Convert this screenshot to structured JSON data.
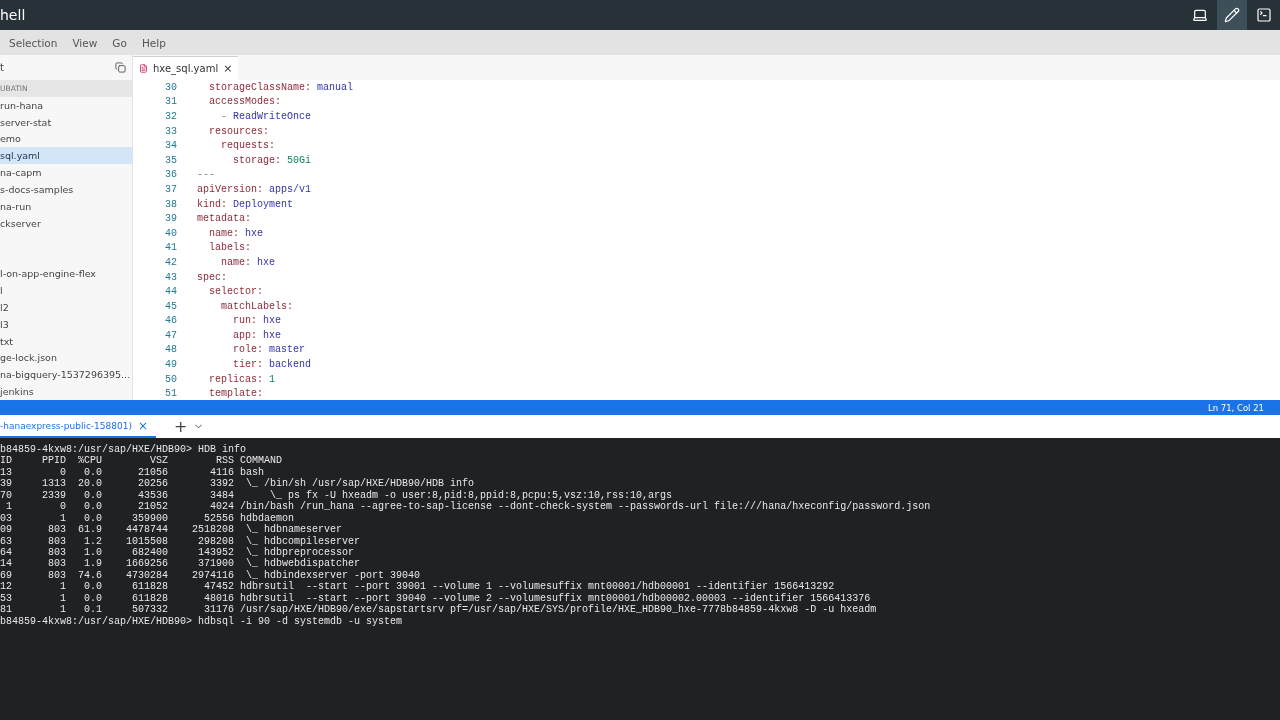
{
  "window": {
    "title": "hell"
  },
  "toolbar": [
    {
      "kind": "laptop",
      "selected": false
    },
    {
      "kind": "edit",
      "selected": true
    },
    {
      "kind": "terminal",
      "selected": false
    }
  ],
  "menu": [
    "Selection",
    "View",
    "Go",
    "Help"
  ],
  "sidebar": {
    "title": "t",
    "items": [
      {
        "label": "UBATIN",
        "kind": "header"
      },
      {
        "label": "run-hana",
        "kind": "item",
        "selected": false
      },
      {
        "label": "server-stat",
        "kind": "item",
        "selected": false
      },
      {
        "label": "emo",
        "kind": "item",
        "selected": false
      },
      {
        "label": "sql.yaml",
        "kind": "item",
        "selected": true
      },
      {
        "label": "na-capm",
        "kind": "item",
        "selected": false
      },
      {
        "label": "s-docs-samples",
        "kind": "item",
        "selected": false
      },
      {
        "label": "na-run",
        "kind": "item",
        "selected": false
      },
      {
        "label": "ckserver",
        "kind": "item",
        "selected": false
      },
      {
        "kind": "blank"
      },
      {
        "kind": "blank"
      },
      {
        "label": "l-on-app-engine-flex",
        "kind": "item",
        "selected": false
      },
      {
        "label": "l",
        "kind": "item",
        "selected": false
      },
      {
        "label": "l2",
        "kind": "item",
        "selected": false
      },
      {
        "label": "l3",
        "kind": "item",
        "selected": false
      },
      {
        "label": "txt",
        "kind": "item",
        "selected": false
      },
      {
        "label": "ge-lock.json",
        "kind": "item",
        "selected": false
      },
      {
        "label": "na-bigquery-1537296395...",
        "kind": "item",
        "selected": false
      },
      {
        "label": "jenkins",
        "kind": "item",
        "selected": false
      }
    ]
  },
  "editor": {
    "tabs": [
      {
        "label": "hxe_sql.yaml",
        "close": "×",
        "selected": true
      }
    ],
    "lines": [
      {
        "number": "30",
        "tokens": [
          {
            "kind": "key",
            "text": "  storageClassName:"
          },
          {
            "kind": "string",
            "text": " manual"
          }
        ]
      },
      {
        "number": "31",
        "tokens": [
          {
            "kind": "key",
            "text": "  accessModes:"
          }
        ]
      },
      {
        "number": "32",
        "tokens": [
          {
            "kind": "plain",
            "text": "    -"
          },
          {
            "kind": "string",
            "text": " ReadWriteOnce"
          }
        ]
      },
      {
        "number": "33",
        "tokens": [
          {
            "kind": "key",
            "text": "  resources:"
          }
        ]
      },
      {
        "number": "34",
        "tokens": [
          {
            "kind": "key",
            "text": "    requests:"
          }
        ]
      },
      {
        "number": "35",
        "tokens": [
          {
            "kind": "key",
            "text": "      storage:"
          },
          {
            "kind": "number",
            "text": " 50Gi"
          }
        ]
      },
      {
        "number": "36",
        "tokens": [
          {
            "kind": "plain",
            "text": "---"
          }
        ]
      },
      {
        "number": "37",
        "tokens": [
          {
            "kind": "key",
            "text": "apiVersion:"
          },
          {
            "kind": "string",
            "text": " apps/v1"
          }
        ]
      },
      {
        "number": "38",
        "tokens": [
          {
            "kind": "key",
            "text": "kind:"
          },
          {
            "kind": "string",
            "text": " Deployment"
          }
        ]
      },
      {
        "number": "39",
        "tokens": [
          {
            "kind": "key",
            "text": "metadata:"
          }
        ]
      },
      {
        "number": "40",
        "tokens": [
          {
            "kind": "key",
            "text": "  name:"
          },
          {
            "kind": "string",
            "text": " hxe"
          }
        ]
      },
      {
        "number": "41",
        "tokens": [
          {
            "kind": "key",
            "text": "  labels:"
          }
        ]
      },
      {
        "number": "42",
        "tokens": [
          {
            "kind": "key",
            "text": "    name:"
          },
          {
            "kind": "string",
            "text": " hxe"
          }
        ]
      },
      {
        "number": "43",
        "tokens": [
          {
            "kind": "key",
            "text": "spec:"
          }
        ]
      },
      {
        "number": "44",
        "tokens": [
          {
            "kind": "key",
            "text": "  selector:"
          }
        ]
      },
      {
        "number": "45",
        "tokens": [
          {
            "kind": "key",
            "text": "    matchLabels:"
          }
        ]
      },
      {
        "number": "46",
        "tokens": [
          {
            "kind": "key",
            "text": "      run:"
          },
          {
            "kind": "string",
            "text": " hxe"
          }
        ]
      },
      {
        "number": "47",
        "tokens": [
          {
            "kind": "key",
            "text": "      app:"
          },
          {
            "kind": "string",
            "text": " hxe"
          }
        ]
      },
      {
        "number": "48",
        "tokens": [
          {
            "kind": "key",
            "text": "      role:"
          },
          {
            "kind": "string",
            "text": " master"
          }
        ]
      },
      {
        "number": "49",
        "tokens": [
          {
            "kind": "key",
            "text": "      tier:"
          },
          {
            "kind": "string",
            "text": " backend"
          }
        ]
      },
      {
        "number": "50",
        "tokens": [
          {
            "kind": "key",
            "text": "  replicas:"
          },
          {
            "kind": "number",
            "text": " 1"
          }
        ]
      },
      {
        "number": "51",
        "tokens": [
          {
            "kind": "key",
            "text": "  template:"
          }
        ]
      }
    ]
  },
  "status_bar": {
    "position": "Ln 71, Col 21"
  },
  "terminal": {
    "tabs": [
      {
        "label": "-hanaexpress-public-158801)",
        "close": "×",
        "selected": true
      }
    ],
    "add": "+",
    "lines": [
      "b84859-4kxw8:/usr/sap/HXE/HDB90> HDB info",
      "ID     PPID  %CPU        VSZ        RSS COMMAND",
      "13        0   0.0      21056       4116 bash",
      "39     1313  20.0      20256       3392  \\_ /bin/sh /usr/sap/HXE/HDB90/HDB info",
      "70     2339   0.0      43536       3484      \\_ ps fx -U hxeadm -o user:8,pid:8,ppid:8,pcpu:5,vsz:10,rss:10,args",
      " 1        0   0.0      21052       4024 /bin/bash /run_hana --agree-to-sap-license --dont-check-system --passwords-url file:///hana/hxeconfig/password.json",
      "03        1   0.0     359900      52556 hdbdaemon",
      "09      803  61.9    4478744    2518208  \\_ hdbnameserver",
      "63      803   1.2    1015508     298208  \\_ hdbcompileserver",
      "64      803   1.0     682400     143952  \\_ hdbpreprocessor",
      "14      803   1.9    1669256     371900  \\_ hdbwebdispatcher",
      "69      803  74.6    4730284    2974116  \\_ hdbindexserver -port 39040",
      "12        1   0.0     611828      47452 hdbrsutil  --start --port 39001 --volume 1 --volumesuffix mnt00001/hdb00001 --identifier 1566413292",
      "53        1   0.0     611828      48016 hdbrsutil  --start --port 39040 --volume 2 --volumesuffix mnt00001/hdb00002.00003 --identifier 1566413376",
      "81        1   0.1     507332      31176 /usr/sap/HXE/HDB90/exe/sapstartsrv pf=/usr/sap/HXE/SYS/profile/HXE_HDB90_hxe-7778b84859-4kxw8 -D -u hxeadm",
      "b84859-4kxw8:/usr/sap/HXE/HDB90> hdbsql -i 90 -d systemdb -u system"
    ]
  }
}
